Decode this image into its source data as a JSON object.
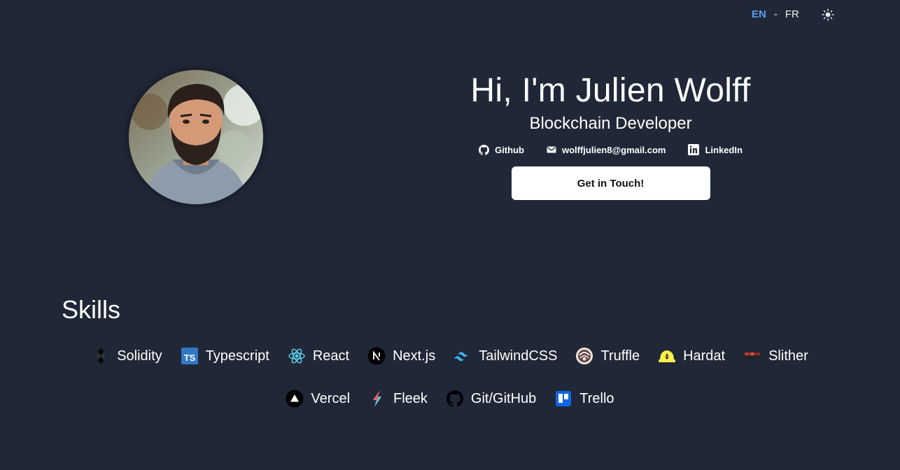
{
  "nav": {
    "lang_en": "EN",
    "separator": "-",
    "lang_fr": "FR",
    "theme_icon": "sun-icon",
    "active_lang_color": "#5b9cf0"
  },
  "hero": {
    "title": "Hi, I'm Julien Wolff",
    "subtitle": "Blockchain Developer",
    "contacts": [
      {
        "label": "Github",
        "icon": "github-icon"
      },
      {
        "label": "wolffjulien8@gmail.com",
        "icon": "mail-icon"
      },
      {
        "label": "LinkedIn",
        "icon": "linkedin-icon"
      }
    ],
    "cta_label": "Get in Touch!"
  },
  "skills": {
    "heading": "Skills",
    "row1": [
      {
        "label": "Solidity",
        "icon": "solidity-icon"
      },
      {
        "label": "Typescript",
        "icon": "typescript-icon"
      },
      {
        "label": "React",
        "icon": "react-icon"
      },
      {
        "label": "Next.js",
        "icon": "nextjs-icon"
      },
      {
        "label": "TailwindCSS",
        "icon": "tailwind-icon"
      },
      {
        "label": "Truffle",
        "icon": "truffle-icon"
      },
      {
        "label": "Hardat",
        "icon": "hardhat-icon"
      },
      {
        "label": "Slither",
        "icon": "slither-icon"
      }
    ],
    "row2": [
      {
        "label": "Vercel",
        "icon": "vercel-icon"
      },
      {
        "label": "Fleek",
        "icon": "fleek-icon"
      },
      {
        "label": "Git/GitHub",
        "icon": "github-icon"
      },
      {
        "label": "Trello",
        "icon": "trello-icon"
      }
    ]
  },
  "colors": {
    "background": "#202838",
    "text": "#ffffff",
    "cta_bg": "#ffffff"
  }
}
